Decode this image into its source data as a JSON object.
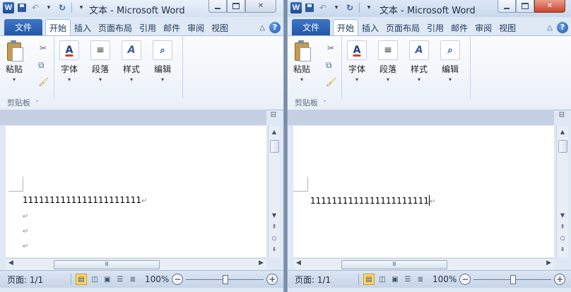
{
  "windows": {
    "left": {
      "title": "文本 - Microsoft Word",
      "tabs": {
        "file": "文件",
        "items": [
          "开始",
          "插入",
          "页面布局",
          "引用",
          "邮件",
          "审阅",
          "视图"
        ]
      },
      "clipboard": {
        "paste": "粘贴",
        "group": "剪贴板"
      },
      "ribbon_buttons": [
        "字体",
        "段落",
        "样式",
        "编辑"
      ],
      "document_lines": [
        "1111111111111111111111",
        "",
        "",
        ""
      ],
      "status": {
        "page": "页面: 1/1",
        "zoom": "100%"
      }
    },
    "right": {
      "title": "文本 - Microsoft Word",
      "tabs": {
        "file": "文件",
        "items": [
          "开始",
          "插入",
          "页面布局",
          "引用",
          "邮件",
          "审阅",
          "视图"
        ]
      },
      "clipboard": {
        "paste": "粘贴",
        "group": "剪贴板"
      },
      "ribbon_buttons": [
        "字体",
        "段落",
        "样式",
        "编辑"
      ],
      "document_lines": [
        "1111111111111111111111"
      ],
      "status": {
        "page": "页面: 1/1",
        "zoom": "100%"
      }
    }
  },
  "icons": {
    "app": "word-icon",
    "save": "save-icon",
    "undo": "undo-icon",
    "redo": "redo-icon",
    "paragraph_mark": "↵",
    "scroll_thumb_grip": "Ⅲ"
  },
  "colors": {
    "file_tab": "#2e64b6",
    "active_view": "#ffd86b",
    "close_button_active": "#c9432c"
  }
}
